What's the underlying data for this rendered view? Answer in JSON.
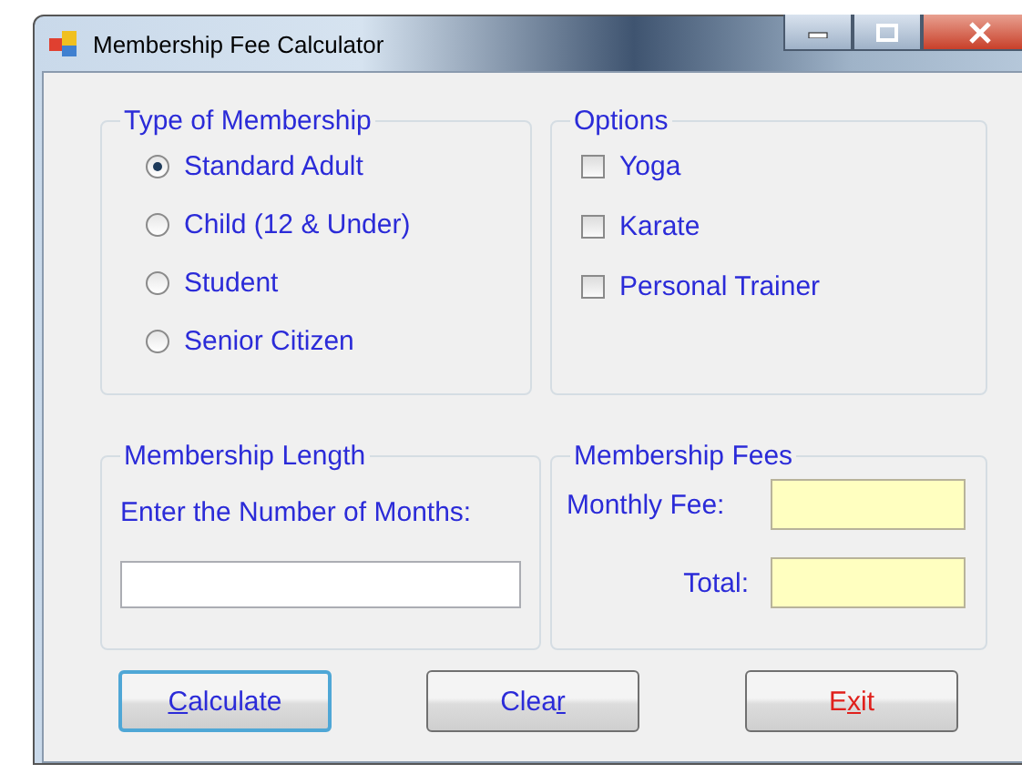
{
  "window": {
    "title": "Membership Fee Calculator"
  },
  "membership_type": {
    "title": "Type of Membership",
    "options": [
      {
        "label": "Standard Adult",
        "selected": true
      },
      {
        "label": "Child (12 & Under)",
        "selected": false
      },
      {
        "label": "Student",
        "selected": false
      },
      {
        "label": "Senior Citizen",
        "selected": false
      }
    ]
  },
  "options": {
    "title": "Options",
    "items": [
      {
        "label": "Yoga",
        "checked": false
      },
      {
        "label": "Karate",
        "checked": false
      },
      {
        "label": "Personal Trainer",
        "checked": false
      }
    ]
  },
  "membership_length": {
    "title": "Membership Length",
    "prompt": "Enter the Number of Months:"
  },
  "fees": {
    "title": "Membership Fees",
    "fields": [
      {
        "label": "Monthly Fee:"
      },
      {
        "label": "Total:"
      }
    ]
  },
  "buttons": [
    {
      "parts": [
        {
          "text": "C",
          "underlined": true
        },
        {
          "text": "alculate",
          "underlined": false
        }
      ],
      "color": "#2b2bd8",
      "default": true
    },
    {
      "parts": [
        {
          "text": "Clea",
          "underlined": false
        },
        {
          "text": "r",
          "underlined": true
        }
      ],
      "color": "#2b2bd8",
      "default": false
    },
    {
      "parts": [
        {
          "text": "E",
          "underlined": false
        },
        {
          "text": "x",
          "underlined": true
        },
        {
          "text": "it",
          "underlined": false
        }
      ],
      "color": "#e0201c",
      "default": false
    }
  ]
}
